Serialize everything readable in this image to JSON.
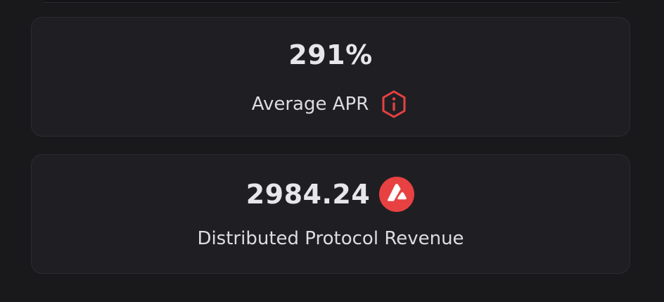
{
  "apr": {
    "value": "291%",
    "label": "Average APR",
    "icon": "info-icon"
  },
  "revenue": {
    "value": "2984.24",
    "label": "Distributed Protocol Revenue",
    "icon": "avax-token-icon"
  },
  "colors": {
    "background": "#19191c",
    "card": "#1f1f23",
    "accent": "#e84142"
  }
}
